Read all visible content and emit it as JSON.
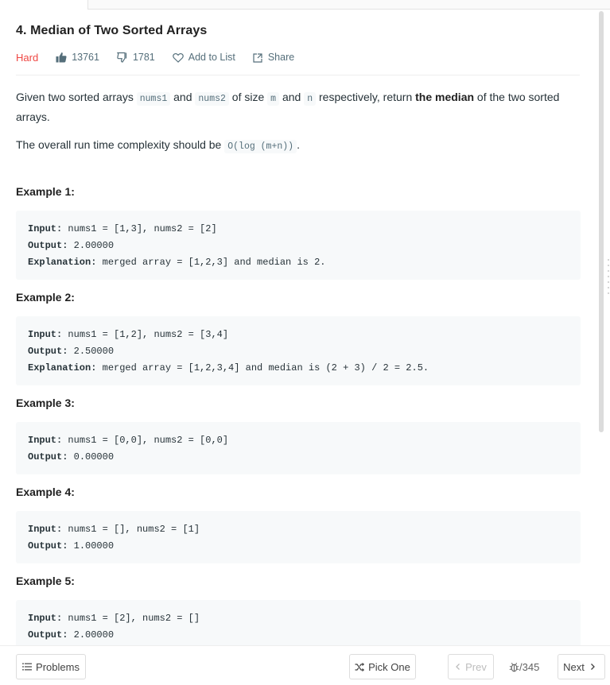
{
  "problem": {
    "title": "4. Median of Two Sorted Arrays",
    "difficulty": "Hard",
    "likes": "13761",
    "dislikes": "1781",
    "add_to_list": "Add to List",
    "share": "Share"
  },
  "description": {
    "p1": {
      "t1": "Given two sorted arrays ",
      "c1": "nums1",
      "t2": " and ",
      "c2": "nums2",
      "t3": " of size ",
      "c3": "m",
      "t4": " and ",
      "c4": "n",
      "t5": " respectively, return ",
      "b1": "the median",
      "t6": " of the two sorted arrays."
    },
    "p2": {
      "t1": "The overall run time complexity should be ",
      "c1": "O(log (m+n))",
      "t2": "."
    }
  },
  "examples": [
    {
      "title": "Example 1:",
      "lines": [
        {
          "key": "Input:",
          "val": " nums1 = [1,3], nums2 = [2]"
        },
        {
          "key": "Output:",
          "val": " 2.00000"
        },
        {
          "key": "Explanation:",
          "val": " merged array = [1,2,3] and median is 2."
        }
      ]
    },
    {
      "title": "Example 2:",
      "lines": [
        {
          "key": "Input:",
          "val": " nums1 = [1,2], nums2 = [3,4]"
        },
        {
          "key": "Output:",
          "val": " 2.50000"
        },
        {
          "key": "Explanation:",
          "val": " merged array = [1,2,3,4] and median is (2 + 3) / 2 = 2.5."
        }
      ]
    },
    {
      "title": "Example 3:",
      "lines": [
        {
          "key": "Input:",
          "val": " nums1 = [0,0], nums2 = [0,0]"
        },
        {
          "key": "Output:",
          "val": " 0.00000"
        }
      ]
    },
    {
      "title": "Example 4:",
      "lines": [
        {
          "key": "Input:",
          "val": " nums1 = [], nums2 = [1]"
        },
        {
          "key": "Output:",
          "val": " 1.00000"
        }
      ]
    },
    {
      "title": "Example 5:",
      "lines": [
        {
          "key": "Input:",
          "val": " nums1 = [2], nums2 = []"
        },
        {
          "key": "Output:",
          "val": " 2.00000"
        }
      ]
    }
  ],
  "footer": {
    "problems": "Problems",
    "pick_one": "Pick One",
    "prev": "Prev",
    "counter": "/345",
    "next": "Next"
  },
  "colors": {
    "difficulty_hard": "#ef4743",
    "code_bg": "#f7f9fa"
  },
  "icons": [
    "thumbs-up-icon",
    "thumbs-down-icon",
    "heart-icon",
    "share-icon",
    "list-icon",
    "shuffle-icon",
    "chevron-left-icon",
    "bug-icon",
    "chevron-right-icon"
  ]
}
